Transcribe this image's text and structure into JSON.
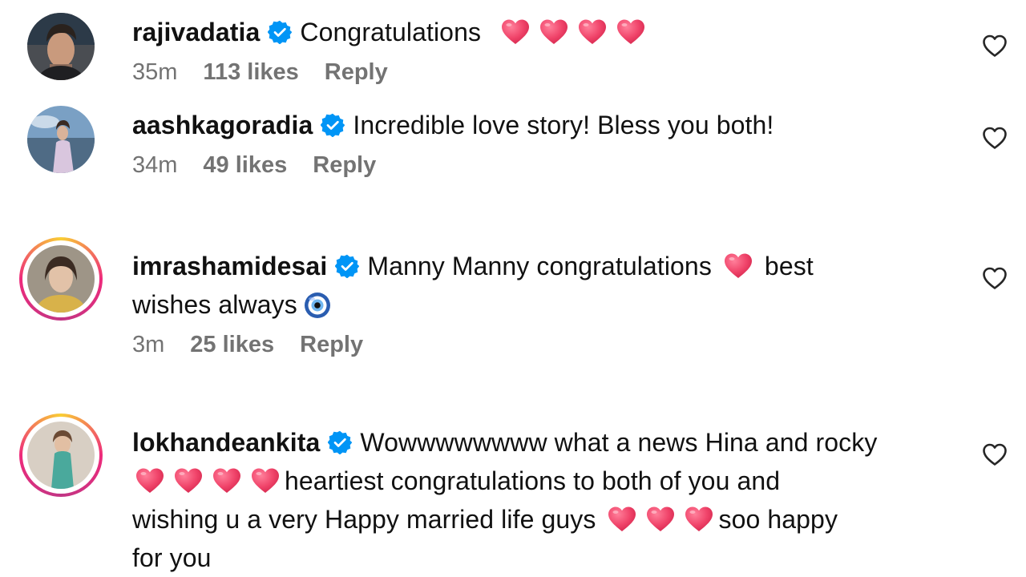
{
  "comments": [
    {
      "username": "rajivadatia",
      "segments": [
        "Congratulations"
      ],
      "time": "35m",
      "likes": "113 likes",
      "reply": "Reply",
      "avatar_icon": "profile-photo-man"
    },
    {
      "username": "aashkagoradia",
      "text": "Incredible love story! Bless you both!",
      "time": "34m",
      "likes": "49 likes",
      "reply": "Reply",
      "avatar_icon": "profile-photo-woman"
    },
    {
      "username": "imrashamidesai",
      "text_a": "Manny Manny congratulations",
      "text_b": "best",
      "text_c": "wishes always",
      "time": "3m",
      "likes": "25 likes",
      "reply": "Reply",
      "avatar_icon": "profile-photo-woman"
    },
    {
      "username": "lokhandeankita",
      "text_a": "Wowwwwwwww what a news Hina and rocky",
      "text_b": "heartiest congratulations to both of you and",
      "text_c": "wishing u a very Happy married life guys",
      "text_d": "soo happy",
      "text_e": "for you",
      "time": "",
      "likes": "",
      "reply": "",
      "avatar_icon": "profile-photo-woman"
    }
  ],
  "colors": {
    "verified_blue": "#0095f6",
    "meta_gray": "#737373",
    "heart_red": "#f0446a",
    "story_ring": [
      "#f9ce34",
      "#ee2a7b",
      "#c13584"
    ]
  },
  "icons": {
    "verified": "verified-badge-icon",
    "like": "heart-outline-icon",
    "heart_emoji": "red-heart-emoji",
    "nazar_emoji": "nazar-amulet-emoji"
  }
}
